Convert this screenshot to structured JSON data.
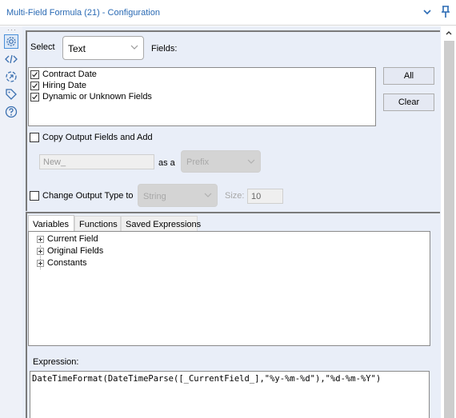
{
  "window": {
    "title": "Multi-Field Formula (21) - Configuration",
    "chevron_icon": "chevron-down-icon",
    "pin_icon": "pin-icon"
  },
  "sidebar": {
    "items": [
      {
        "icon": "gear-icon",
        "selected": true
      },
      {
        "icon": "code-icon",
        "selected": false
      },
      {
        "icon": "refresh-target-icon",
        "selected": false
      },
      {
        "icon": "tag-icon",
        "selected": false
      },
      {
        "icon": "help-icon",
        "selected": false
      }
    ]
  },
  "select_section": {
    "select_label": "Select",
    "select_value": "Text",
    "fields_label": "Fields:",
    "fields": [
      {
        "label": "Contract Date",
        "checked": true
      },
      {
        "label": "Hiring Date",
        "checked": true
      },
      {
        "label": "Dynamic or Unknown Fields",
        "checked": true
      }
    ],
    "all_button": "All",
    "clear_button": "Clear"
  },
  "copy_output": {
    "label": "Copy Output Fields and Add",
    "checked": false,
    "text_value": "New_",
    "as_a_label": "as a",
    "position_value": "Prefix"
  },
  "change_type": {
    "label": "Change Output Type to",
    "checked": false,
    "type_value": "String",
    "size_label": "Size:",
    "size_value": "10"
  },
  "expression_panel": {
    "tabs": [
      {
        "label": "Variables",
        "active": true
      },
      {
        "label": "Functions",
        "active": false
      },
      {
        "label": "Saved Expressions",
        "active": false
      }
    ],
    "tree": [
      "Current Field",
      "Original Fields",
      "Constants"
    ],
    "expression_label": "Expression:",
    "expression": "DateTimeFormat(DateTimeParse([_CurrentField_],\"%y-%m-%d\"),\"%d-%m-%Y\")"
  },
  "colors": {
    "title": "#2a6ab4",
    "panel_bg": "#e9eef8",
    "accent": "#4a8fd9"
  }
}
